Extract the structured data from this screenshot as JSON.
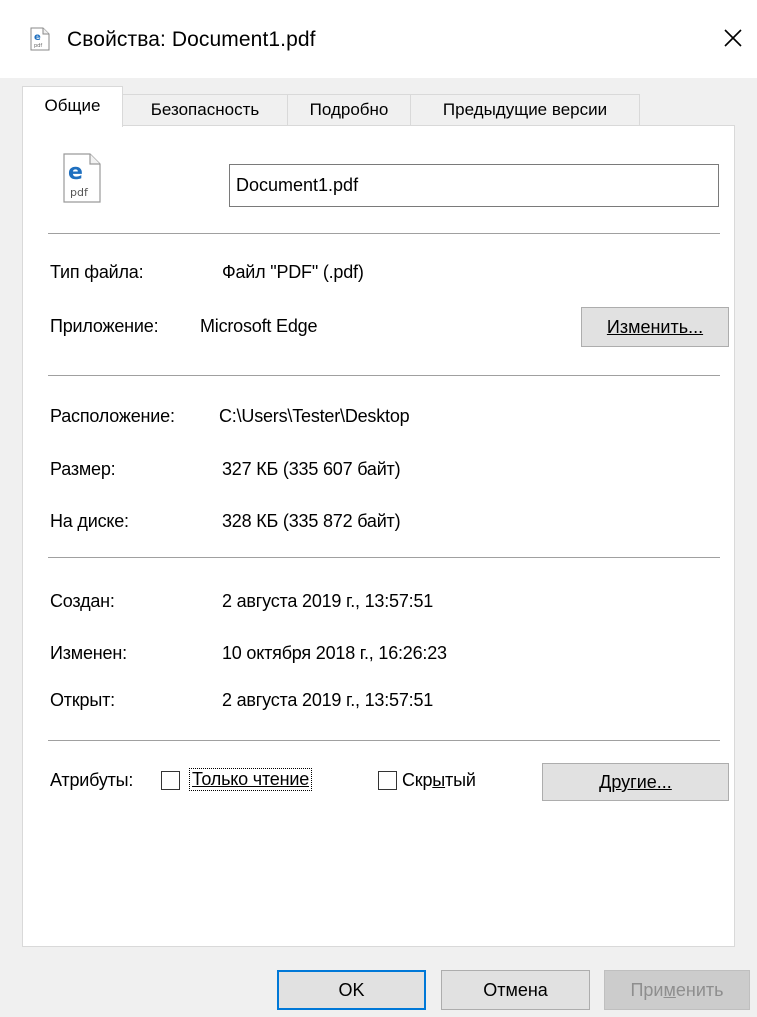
{
  "window": {
    "title": "Свойства: Document1.pdf",
    "close_glyph": "✕"
  },
  "tabs": [
    {
      "label": "Общие",
      "active": true
    },
    {
      "label": "Безопасность",
      "active": false
    },
    {
      "label": "Подробно",
      "active": false
    },
    {
      "label": "Предыдущие версии",
      "active": false
    }
  ],
  "file_icon": {
    "badge": "e",
    "ext": "pdf"
  },
  "filename": "Document1.pdf",
  "type_section": {
    "file_type_label": "Тип файла:",
    "file_type_value": "Файл \"PDF\" (.pdf)",
    "app_label": "Приложение:",
    "app_value": "Microsoft Edge",
    "change_button": "Изменить..."
  },
  "location_section": {
    "location_label": "Расположение:",
    "location_value": "C:\\Users\\Tester\\Desktop",
    "size_label": "Размер:",
    "size_value": "327 КБ (335 607 байт)",
    "disk_label": "На диске:",
    "disk_value": "328 КБ (335 872 байт)"
  },
  "dates_section": {
    "created_label": "Создан:",
    "created_value": "2 августа 2019 г., 13:57:51",
    "modified_label": "Изменен:",
    "modified_value": "10 октября 2018 г., 16:26:23",
    "opened_label": "Открыт:",
    "opened_value": "2 августа 2019 г., 13:57:51"
  },
  "attributes": {
    "label": "Атрибуты:",
    "readonly_label": "Только чтение",
    "readonly_checked": false,
    "hidden_label": "Скрытый",
    "hidden_checked": false,
    "other_button": "Другие..."
  },
  "footer": {
    "ok": "OK",
    "cancel": "Отмена",
    "apply": "Применить"
  },
  "colors": {
    "accent": "#0078d7",
    "edge_blue": "#1e6fbf",
    "window_bg": "#f0f0f0"
  }
}
